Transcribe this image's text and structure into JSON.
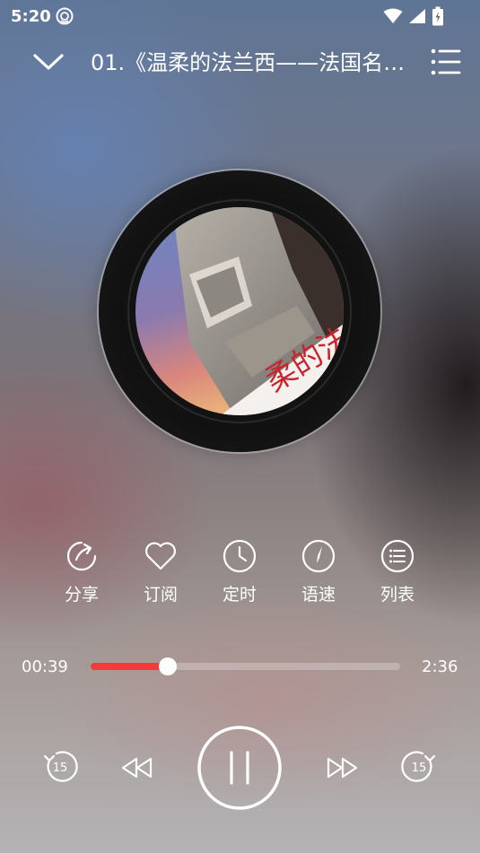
{
  "status_bar": {
    "time": "5:20",
    "icons": [
      "notification-icon",
      "wifi-icon",
      "signal-icon",
      "battery-charging-icon"
    ]
  },
  "header": {
    "title": "01.《温柔的法兰西——法国名…",
    "left_icon": "chevron-down-icon",
    "right_icon": "playlist-icon"
  },
  "album": {
    "cover_text": "柔的法"
  },
  "actions": [
    {
      "label": "分享",
      "icon": "share-icon"
    },
    {
      "label": "订阅",
      "icon": "heart-icon"
    },
    {
      "label": "定时",
      "icon": "clock-icon"
    },
    {
      "label": "语速",
      "icon": "speed-icon"
    },
    {
      "label": "列表",
      "icon": "list-icon"
    }
  ],
  "progress": {
    "current": "00:39",
    "total": "2:36",
    "fraction": 0.25
  },
  "controls": {
    "rewind_seconds": "15",
    "forward_seconds": "15",
    "state": "playing"
  },
  "colors": {
    "accent": "#f43a3e"
  }
}
